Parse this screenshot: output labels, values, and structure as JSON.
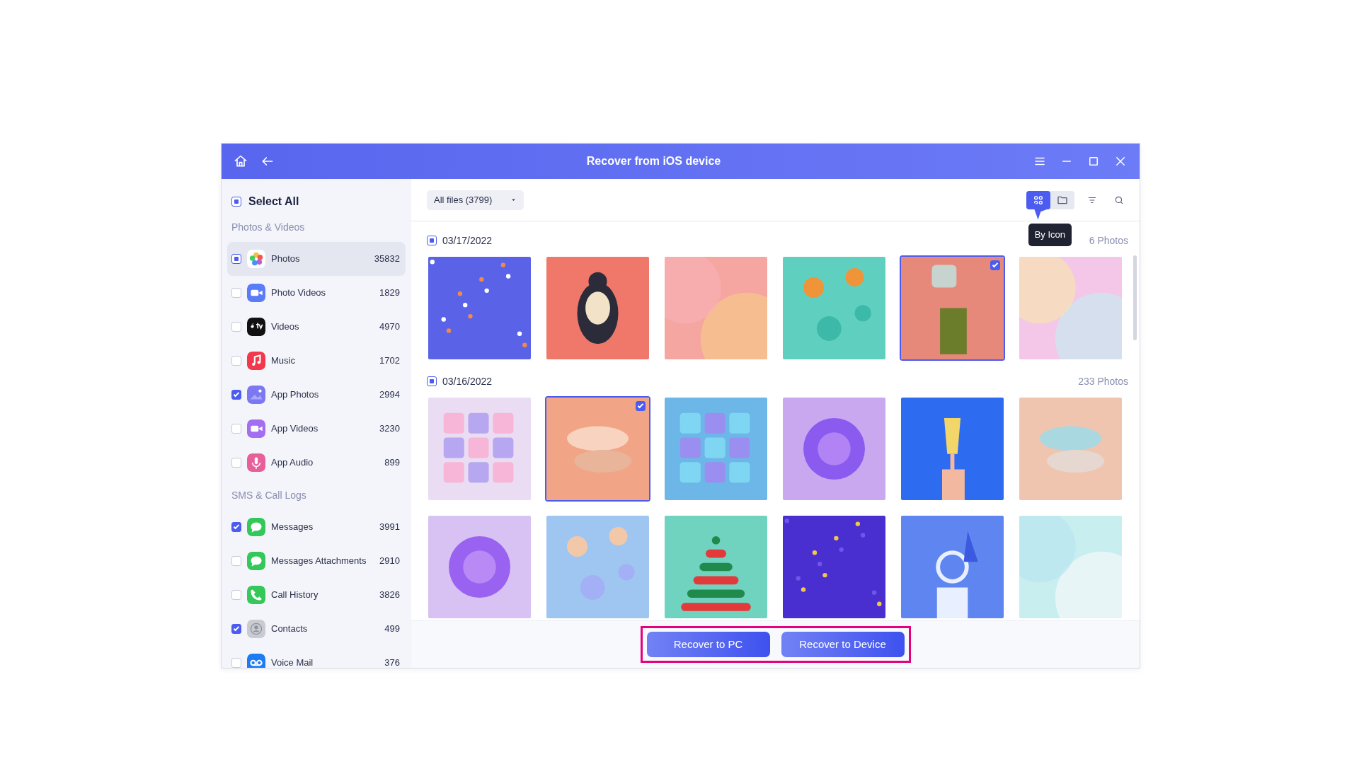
{
  "window": {
    "title": "Recover from iOS device"
  },
  "sidebar": {
    "select_all": {
      "label": "Select All",
      "checked": true,
      "partial": true
    },
    "sections": [
      {
        "title": "Photos & Videos",
        "items": [
          {
            "label": "Photos",
            "count": "35832",
            "checked": true,
            "partial": true,
            "selected": true
          },
          {
            "label": "Photo Videos",
            "count": "1829",
            "checked": false,
            "partial": false,
            "selected": false
          },
          {
            "label": "Videos",
            "count": "4970",
            "checked": false,
            "partial": false,
            "selected": false
          },
          {
            "label": "Music",
            "count": "1702",
            "checked": false,
            "partial": false,
            "selected": false
          },
          {
            "label": "App Photos",
            "count": "2994",
            "checked": true,
            "partial": false,
            "selected": false
          },
          {
            "label": "App Videos",
            "count": "3230",
            "checked": false,
            "partial": false,
            "selected": false
          },
          {
            "label": "App Audio",
            "count": "899",
            "checked": false,
            "partial": false,
            "selected": false
          }
        ]
      },
      {
        "title": "SMS & Call Logs",
        "items": [
          {
            "label": "Messages",
            "count": "3991",
            "checked": true,
            "partial": false,
            "selected": false
          },
          {
            "label": "Messages Attachments",
            "count": "2910",
            "checked": false,
            "partial": false,
            "selected": false
          },
          {
            "label": "Call History",
            "count": "3826",
            "checked": false,
            "partial": false,
            "selected": false
          },
          {
            "label": "Contacts",
            "count": "499",
            "checked": true,
            "partial": false,
            "selected": false
          },
          {
            "label": "Voice Mail",
            "count": "376",
            "checked": false,
            "partial": false,
            "selected": false
          }
        ]
      }
    ]
  },
  "toolbar": {
    "filter": "All files (3799)",
    "views": [
      {
        "selected": true
      },
      {
        "selected": false
      }
    ],
    "tooltip": "By Icon"
  },
  "groups": [
    {
      "date": "03/17/2022",
      "count": "6 Photos",
      "checked": true,
      "partial": true,
      "photos": [
        {
          "kind": "picture",
          "selected": false
        },
        {
          "kind": "picture",
          "selected": false
        },
        {
          "kind": "picture",
          "selected": false
        },
        {
          "kind": "picture",
          "selected": false
        },
        {
          "kind": "picture",
          "selected": true
        },
        {
          "kind": "picture",
          "selected": false
        }
      ]
    },
    {
      "date": "03/16/2022",
      "count": "233 Photos",
      "checked": true,
      "partial": true,
      "photos": [
        {
          "kind": "picture",
          "selected": false
        },
        {
          "kind": "picture",
          "selected": true
        },
        {
          "kind": "picture",
          "selected": false
        },
        {
          "kind": "picture",
          "selected": false
        },
        {
          "kind": "picture",
          "selected": false
        },
        {
          "kind": "picture",
          "selected": false
        },
        {
          "kind": "picture",
          "selected": false
        },
        {
          "kind": "picture",
          "selected": false
        },
        {
          "kind": "picture",
          "selected": false
        },
        {
          "kind": "picture",
          "selected": false
        },
        {
          "kind": "picture",
          "selected": false
        },
        {
          "kind": "picture",
          "selected": false
        }
      ]
    }
  ],
  "actions": [
    "Recover to PC",
    "Recover to Device"
  ]
}
